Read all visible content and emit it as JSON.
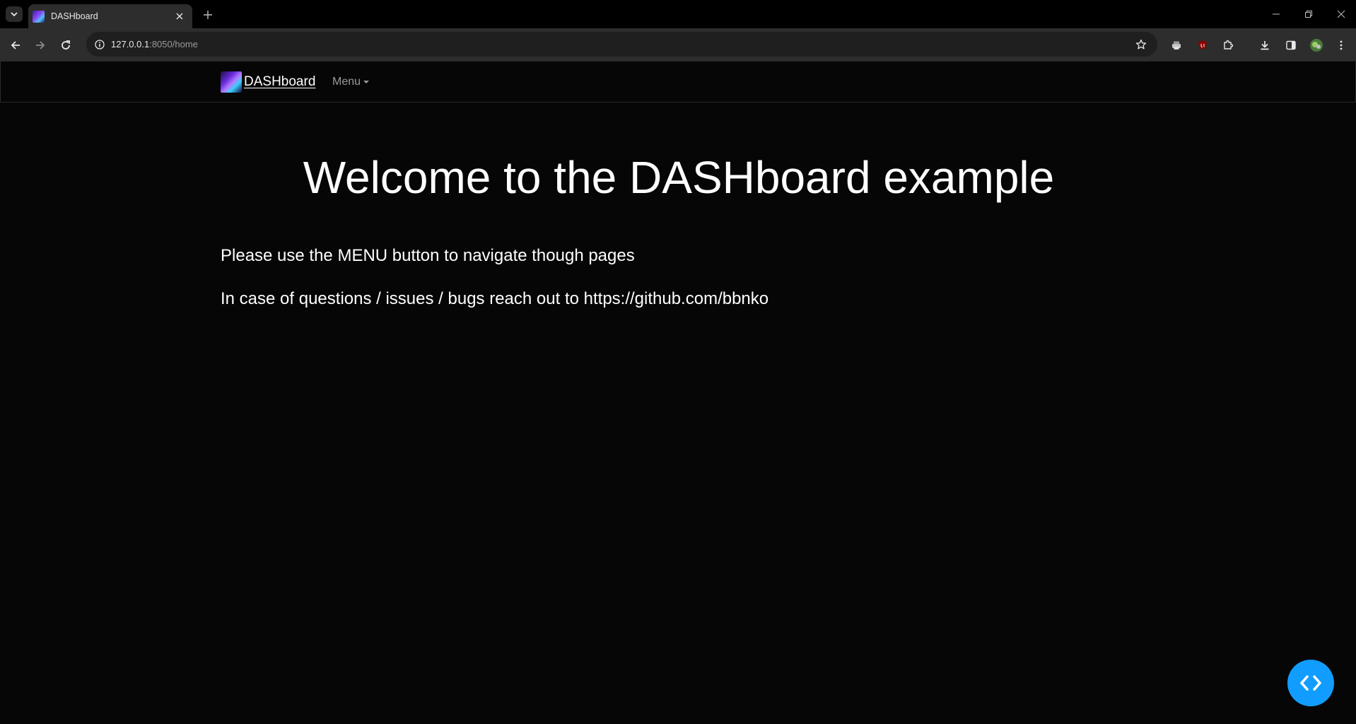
{
  "browser": {
    "tab": {
      "title": "DASHboard"
    },
    "url": {
      "host": "127.0.0.1",
      "rest": ":8050/home"
    }
  },
  "navbar": {
    "brand": "DASHboard",
    "menu_label": "Menu"
  },
  "main": {
    "title": "Welcome to the DASHboard example",
    "paragraphs": [
      "Please use the MENU button to navigate though pages",
      "In case of questions / issues / bugs reach out to https://github.com/bbnko"
    ]
  },
  "colors": {
    "background": "#060606",
    "fab": "#119dff"
  }
}
